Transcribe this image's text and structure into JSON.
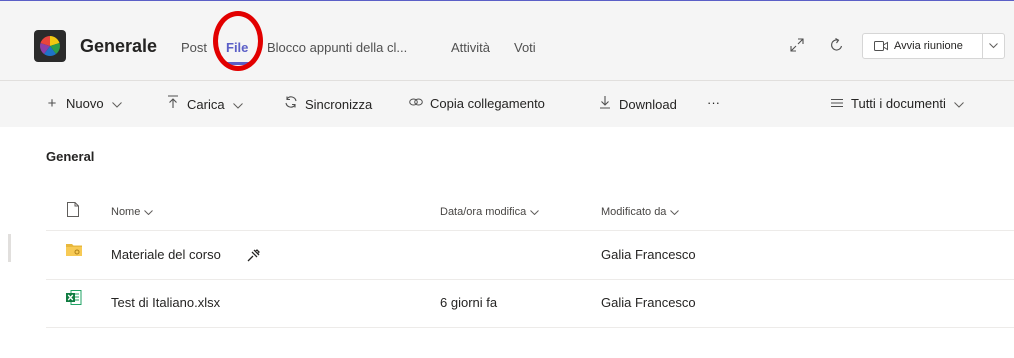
{
  "header": {
    "channel_name": "Generale",
    "tabs": [
      {
        "label": "Post",
        "active": false
      },
      {
        "label": "File",
        "active": true
      },
      {
        "label": "Blocco appunti della cl...",
        "active": false
      },
      {
        "label": "Attività",
        "active": false
      },
      {
        "label": "Voti",
        "active": false
      }
    ],
    "meeting_button": "Avvia riunione",
    "icons": [
      "expand-icon",
      "refresh-icon",
      "video-camera-icon",
      "chevron-down-icon"
    ],
    "accent_color": "#5b5fc7",
    "highlight_color": "#e20000"
  },
  "toolbar": {
    "new": "Nuovo",
    "upload": "Carica",
    "sync": "Sincronizza",
    "copy_link": "Copia collegamento",
    "download": "Download",
    "more": "···",
    "view": "Tutti i documenti"
  },
  "library": {
    "folder": "General",
    "columns": {
      "name": "Nome",
      "modified": "Data/ora modifica",
      "modified_by": "Modificato da"
    },
    "rows": [
      {
        "name": "Materiale del corso",
        "type": "folder-icon",
        "modified": "",
        "modified_by": "Galia Francesco"
      },
      {
        "name": "Test di Italiano.xlsx",
        "type": "excel-file-icon",
        "modified": "6 giorni fa",
        "modified_by": "Galia Francesco"
      }
    ]
  }
}
